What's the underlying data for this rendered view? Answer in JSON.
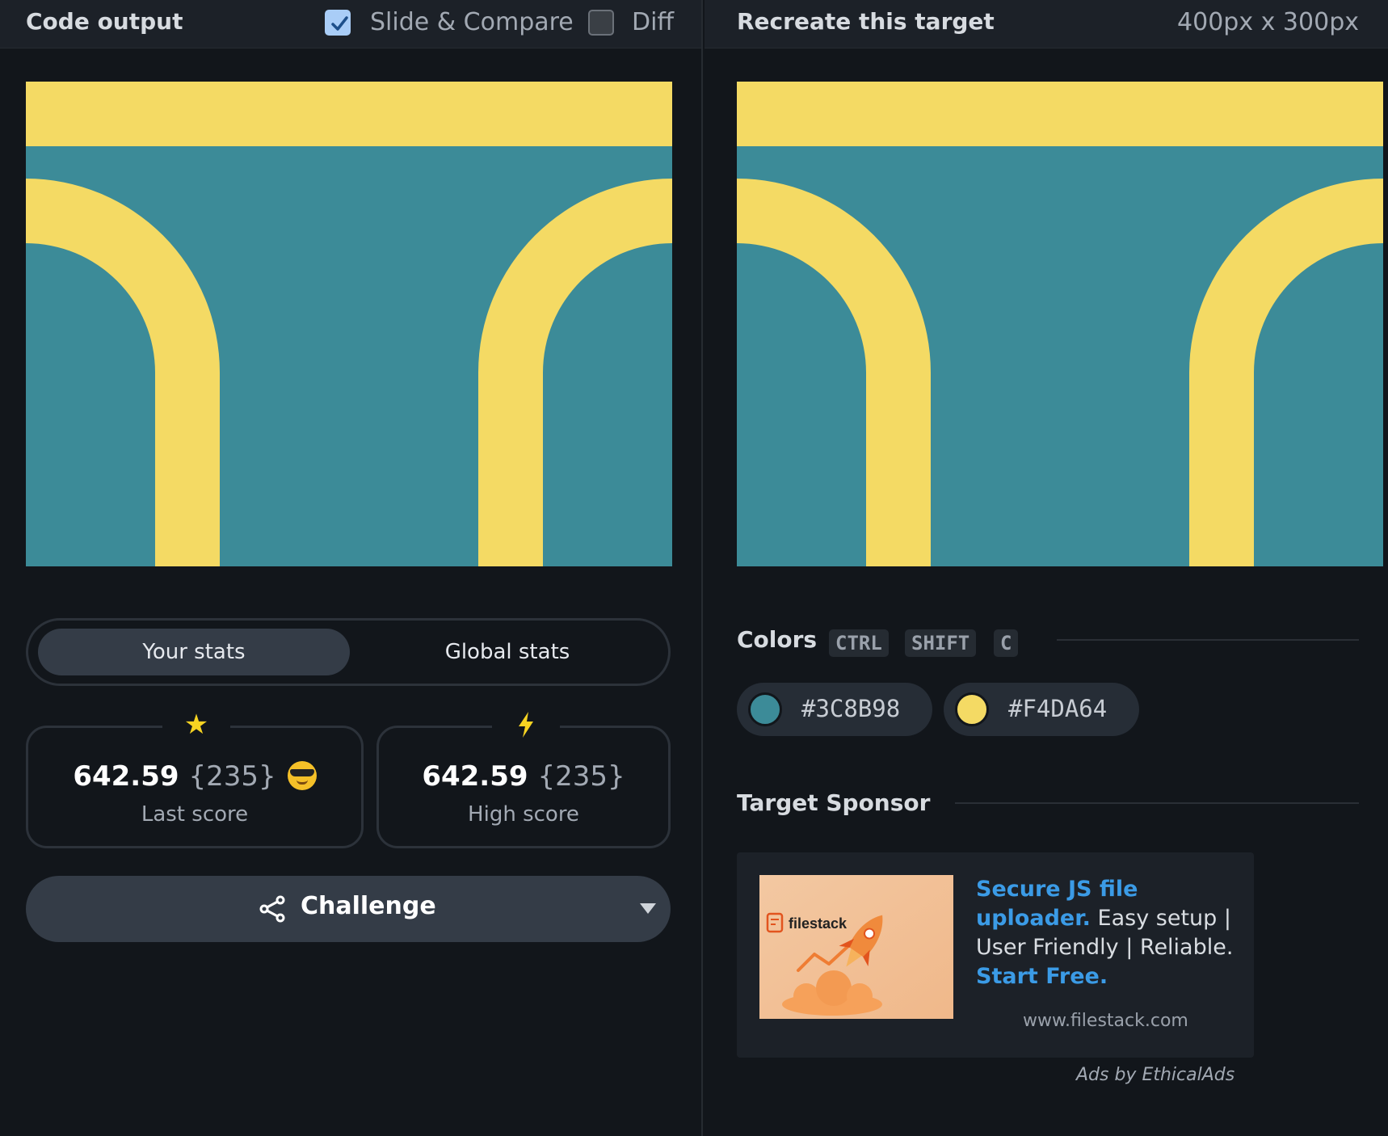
{
  "left_panel": {
    "title": "Code output",
    "slide_compare": {
      "label": "Slide & Compare",
      "checked": true
    },
    "diff": {
      "label": "Diff",
      "checked": false
    }
  },
  "right_panel": {
    "title": "Recreate this target",
    "dimensions": "400px x 300px"
  },
  "target_colors": {
    "teal": "#3C8B98",
    "yellow": "#F4DA64"
  },
  "stats": {
    "tabs": [
      {
        "label": "Your stats",
        "active": true
      },
      {
        "label": "Global stats",
        "active": false
      }
    ],
    "last": {
      "score": "642.59",
      "chars": "{235}",
      "label": "Last score",
      "icon": "star-icon"
    },
    "high": {
      "score": "642.59",
      "chars": "{235}",
      "label": "High score",
      "icon": "lightning-icon"
    }
  },
  "challenge": {
    "label": "Challenge"
  },
  "colors_section": {
    "title": "Colors",
    "shortcut": [
      "CTRL",
      "SHIFT",
      "C"
    ],
    "swatches": [
      {
        "hex": "#3C8B98"
      },
      {
        "hex": "#F4DA64"
      }
    ]
  },
  "sponsor": {
    "title": "Target Sponsor",
    "brand": "filestack",
    "headline": "Secure JS file uploader.",
    "body": "Easy setup | User Friendly | Reliable.",
    "cta": "Start Free.",
    "url": "www.filestack.com",
    "ads_by": "Ads by EthicalAds"
  }
}
